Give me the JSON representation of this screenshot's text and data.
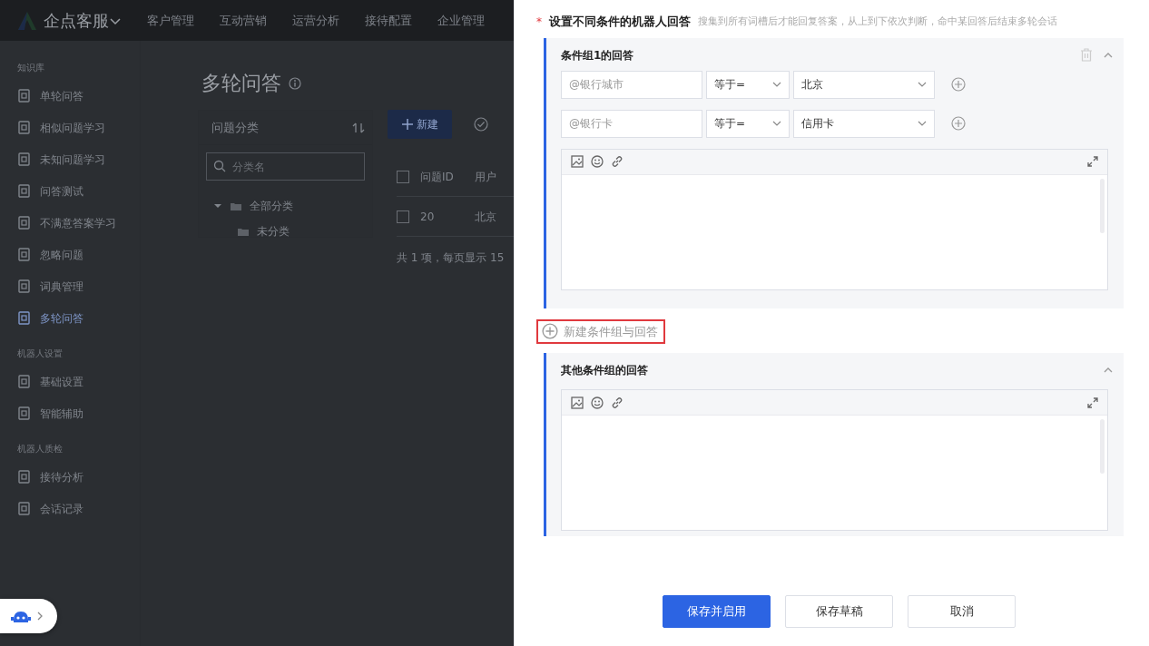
{
  "top_nav": {
    "brand": "企点客服",
    "items": [
      {
        "label": "客户管理",
        "selected": false
      },
      {
        "label": "互动营销",
        "selected": false
      },
      {
        "label": "运营分析",
        "selected": false
      },
      {
        "label": "接待配置",
        "selected": false
      },
      {
        "label": "企业管理",
        "selected": false
      }
    ]
  },
  "sidebar": {
    "sections": [
      {
        "title": "知识库",
        "items": [
          {
            "label": "单轮问答",
            "selected": false
          },
          {
            "label": "相似问题学习",
            "selected": false
          },
          {
            "label": "未知问题学习",
            "selected": false
          },
          {
            "label": "问答测试",
            "selected": false
          },
          {
            "label": "不满意答案学习",
            "selected": false
          },
          {
            "label": "忽略问题",
            "selected": false
          },
          {
            "label": "词典管理",
            "selected": false
          },
          {
            "label": "多轮问答",
            "selected": true
          }
        ]
      },
      {
        "title": "机器人设置",
        "items": [
          {
            "label": "基础设置",
            "selected": false
          },
          {
            "label": "智能辅助",
            "selected": false
          }
        ]
      },
      {
        "title": "机器人质检",
        "items": [
          {
            "label": "接待分析",
            "selected": false
          },
          {
            "label": "会话记录",
            "selected": false
          }
        ]
      }
    ]
  },
  "page": {
    "title": "多轮问答",
    "category_panel": {
      "title": "问题分类",
      "search": {
        "placeholder": "分类名"
      },
      "tree": [
        {
          "label": "全部分类",
          "expanded": true,
          "children": [
            {
              "label": "未分类"
            }
          ]
        }
      ]
    },
    "new_button": "新建",
    "table": {
      "header_checked": false,
      "columns": [
        "问题ID",
        "用户"
      ],
      "rows": [
        {
          "checked": false,
          "cells": [
            "20",
            "北京"
          ]
        }
      ]
    },
    "footer": "共 1 项，每页显示 15"
  },
  "drawer": {
    "required_mark": "*",
    "field_label": "设置不同条件的机器人回答",
    "hint": "搜集到所有词槽后才能回复答案，从上到下依次判断，命中某回答后结束多轮会话",
    "condition_groups": [
      {
        "title": "条件组1的回答",
        "conditions": [
          {
            "slot": "@银行城市",
            "operator": "等于=",
            "value": "北京"
          },
          {
            "slot": "@银行卡",
            "operator": "等于=",
            "value": "信用卡"
          }
        ]
      }
    ],
    "add_group_button": "新建条件组与回答",
    "other_group": {
      "title": "其他条件组的回答"
    },
    "buttons": [
      {
        "label": "保存并启用",
        "primary": true
      },
      {
        "label": "保存草稿",
        "primary": false
      },
      {
        "label": "取消",
        "primary": false
      }
    ]
  }
}
